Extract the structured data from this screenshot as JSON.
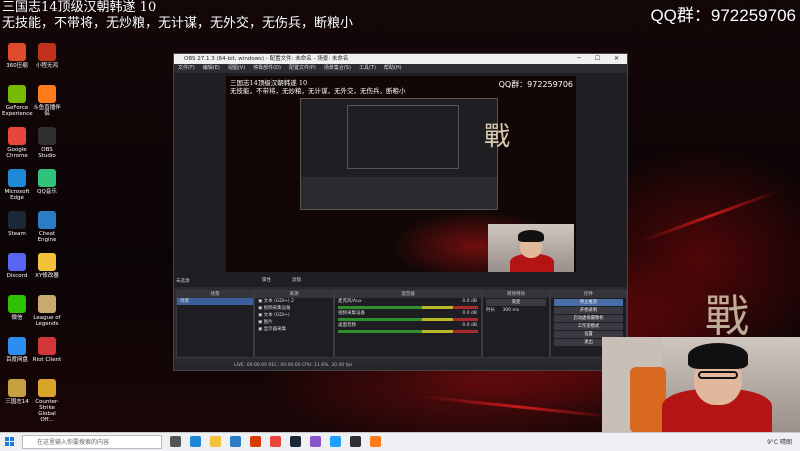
{
  "overlay": {
    "ticker_line1": "三国志14顶级汉朝韩遂 10",
    "ticker_line2": "无技能，不带将，无炒粮，无计谋，无外交，无伤兵，断粮小",
    "qq_group": "QQ群：972259706"
  },
  "desktop_icons": [
    {
      "label": "360压缩",
      "color": "#e04a2a"
    },
    {
      "label": "GeForce Experience",
      "color": "#76b900"
    },
    {
      "label": "Google Chrome",
      "color": "#e8453c"
    },
    {
      "label": "Microsoft Edge",
      "color": "#1e88d8"
    },
    {
      "label": "Steam",
      "color": "#1b2838"
    },
    {
      "label": "Discord",
      "color": "#5865f2"
    },
    {
      "label": "微信",
      "color": "#2dc100"
    },
    {
      "label": "百度网盘",
      "color": "#2e8ef0"
    },
    {
      "label": "三国志14",
      "color": "#c8a040"
    },
    {
      "label": "小程无鸿",
      "color": "#c0301a"
    },
    {
      "label": "斗鱼直播伴侣",
      "color": "#ff7a1a"
    },
    {
      "label": "OBS Studio",
      "color": "#302e31"
    },
    {
      "label": "QQ音乐",
      "color": "#31c27c"
    },
    {
      "label": "Cheat Engine",
      "color": "#2a7cc7"
    },
    {
      "label": "XY修改器",
      "color": "#f2c23a"
    },
    {
      "label": "League of Legends",
      "color": "#c8aa6e"
    },
    {
      "label": "Riot Client",
      "color": "#d13639"
    },
    {
      "label": "Counter-Strike Global Off...",
      "color": "#d9a42a"
    }
  ],
  "obs": {
    "title": "OBS 27.1.3 (64-bit, windows) - 配置文件: 未命名 - 场景: 未命名",
    "menu": [
      "文件(F)",
      "编辑(E)",
      "视图(V)",
      "停靠部件(D)",
      "配置文件(P)",
      "场景集合(S)",
      "工具(T)",
      "帮助(H)"
    ],
    "preview_ticker": "三国志14顶级汉朝韩遂 10",
    "preview_ticker2": "无技能，不带将，无炒粮，无计谋，无外交，无伤兵，断粮小",
    "preview_qq": "QQ群：972259706",
    "no_source_label": "未选源",
    "prop_btn": "属性",
    "filter_btn": "滤镜",
    "docks": {
      "scenes_title": "场景",
      "scenes": [
        "场景"
      ],
      "sources_title": "来源",
      "sources": [
        "文本 (GDI+) 2",
        "视频采集设备",
        "文本 (GDI+)",
        "图片",
        "显示器采集"
      ],
      "mixer_title": "混音器",
      "mixer": [
        {
          "name": "麦克风/Aux",
          "db": "0.0 dB"
        },
        {
          "name": "视频采集设备",
          "db": "0.0 dB"
        },
        {
          "name": "桌面音频",
          "db": "0.0 dB"
        }
      ],
      "transitions_title": "转场特效",
      "transition_value": "渐变",
      "duration_label": "时长",
      "duration_value": "300 ms",
      "controls_title": "控件",
      "controls": [
        "停止推流",
        "开始录制",
        "启动虚拟摄像机",
        "工作室模式",
        "设置",
        "退出"
      ]
    },
    "status": "LIVE: 00:00:00   REC: 00:00:00   CPU: 11.6%, 30.00 fps"
  },
  "taskbar": {
    "search_placeholder": "在这里输入你要搜索的内容",
    "weather": "9°C 晴朗",
    "apps": [
      {
        "name": "task-view",
        "color": "#555555"
      },
      {
        "name": "edge",
        "color": "#1e88d8"
      },
      {
        "name": "explorer",
        "color": "#f2c23a"
      },
      {
        "name": "store",
        "color": "#2a7cc7"
      },
      {
        "name": "office",
        "color": "#d83b01"
      },
      {
        "name": "chrome",
        "color": "#e8453c"
      },
      {
        "name": "steam",
        "color": "#1b2838"
      },
      {
        "name": "app",
        "color": "#8855cc"
      },
      {
        "name": "qq",
        "color": "#1e9fff"
      },
      {
        "name": "obs",
        "color": "#302e31"
      },
      {
        "name": "douyu",
        "color": "#ff7a1a"
      }
    ]
  }
}
